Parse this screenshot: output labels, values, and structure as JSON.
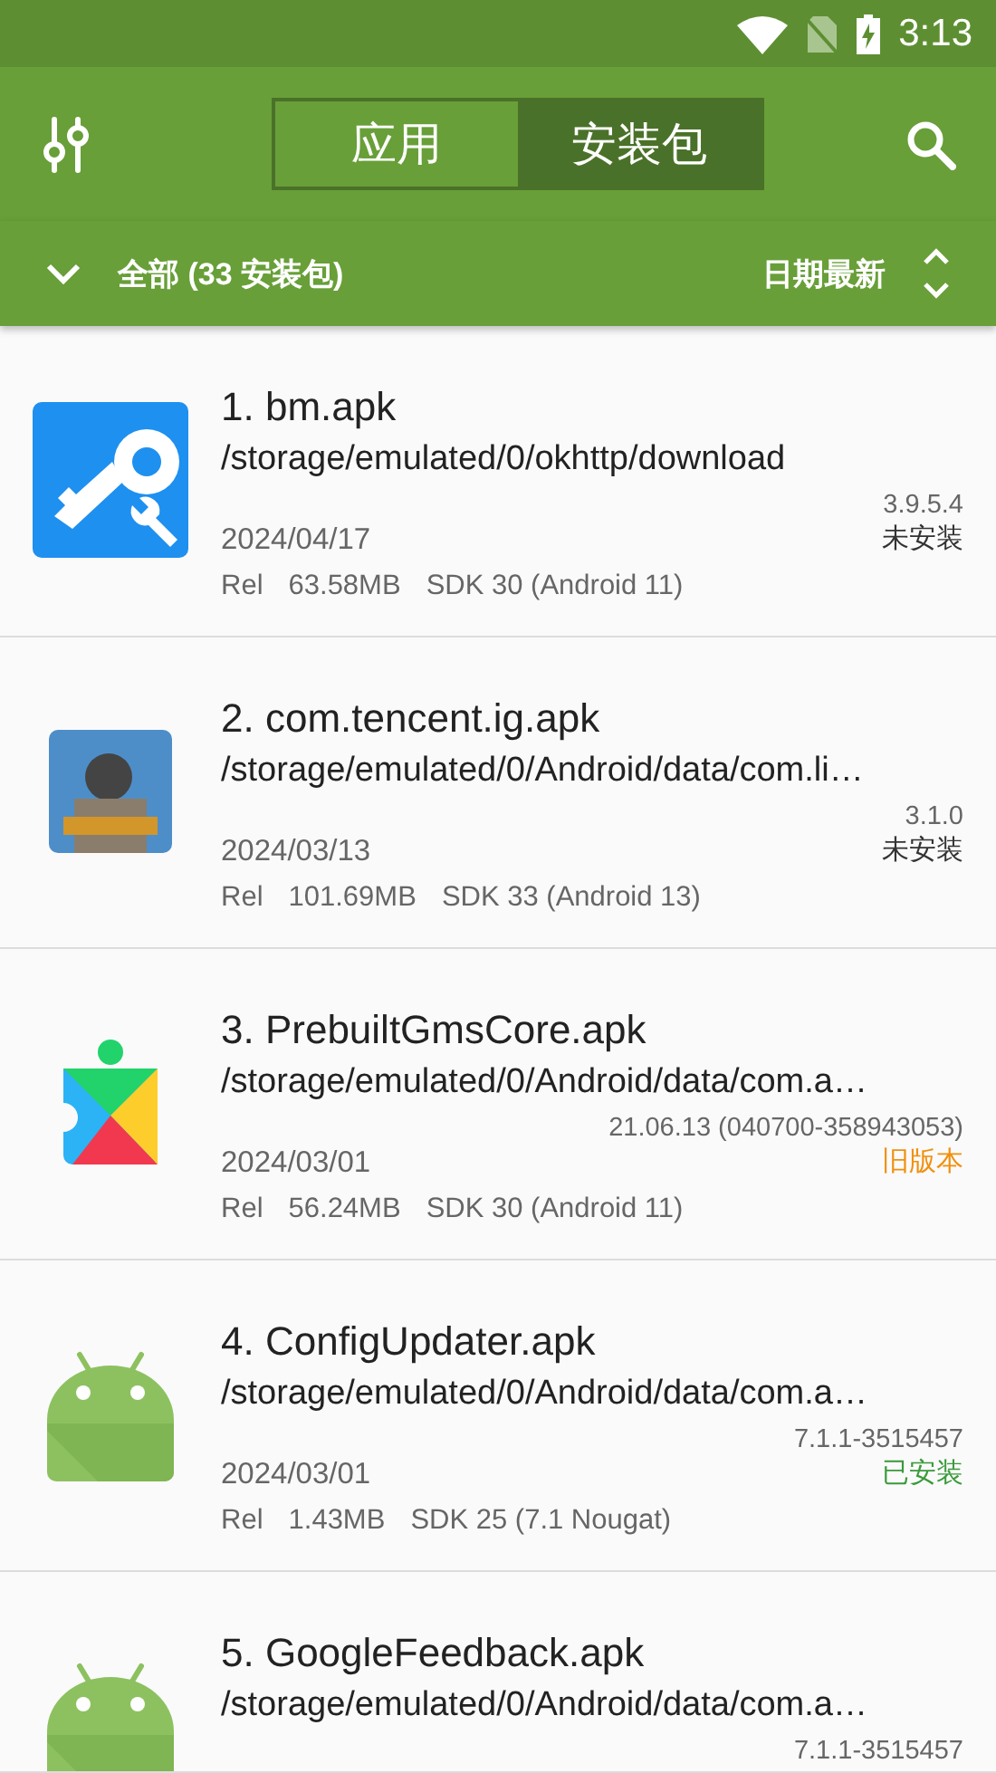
{
  "status_bar": {
    "time": "3:13"
  },
  "toolbar": {
    "tabs": [
      {
        "label": "应用",
        "selected": false
      },
      {
        "label": "安装包",
        "selected": true
      }
    ]
  },
  "filter_bar": {
    "filter": "全部 (33 安装包)",
    "sort": "日期最新"
  },
  "packages": [
    {
      "kind": "key",
      "title": "1. bm.apk",
      "path": "/storage/emulated/0/okhttp/download",
      "version": "3.9.5.4",
      "date": "2024/04/17",
      "status": "未安装",
      "color": "#333333",
      "build": "Rel",
      "size": "63.58MB",
      "sdk": "SDK 30 (Android 11)"
    },
    {
      "kind": "game",
      "title": "2. com.tencent.ig.apk",
      "path": "/storage/emulated/0/Android/data/com.li…",
      "version": "3.1.0",
      "date": "2024/03/13",
      "status": "未安装",
      "color": "#333333",
      "build": "Rel",
      "size": "101.69MB",
      "sdk": "SDK 33 (Android 13)"
    },
    {
      "kind": "puzzle",
      "title": "3. PrebuiltGmsCore.apk",
      "path": "/storage/emulated/0/Android/data/com.a…",
      "version": "21.06.13 (040700-358943053)",
      "date": "2024/03/01",
      "status": "旧版本",
      "color": "#f0900f",
      "build": "Rel",
      "size": "56.24MB",
      "sdk": "SDK 30 (Android 11)"
    },
    {
      "kind": "android",
      "title": "4. ConfigUpdater.apk",
      "path": "/storage/emulated/0/Android/data/com.a…",
      "version": "7.1.1-3515457",
      "date": "2024/03/01",
      "status": "已安装",
      "color": "#3a9a3a",
      "build": "Rel",
      "size": "1.43MB",
      "sdk": "SDK 25 (7.1 Nougat)"
    },
    {
      "kind": "android",
      "title": "5. GoogleFeedback.apk",
      "path": "/storage/emulated/0/Android/data/com.a…",
      "version": "7.1.1-3515457"
    }
  ]
}
